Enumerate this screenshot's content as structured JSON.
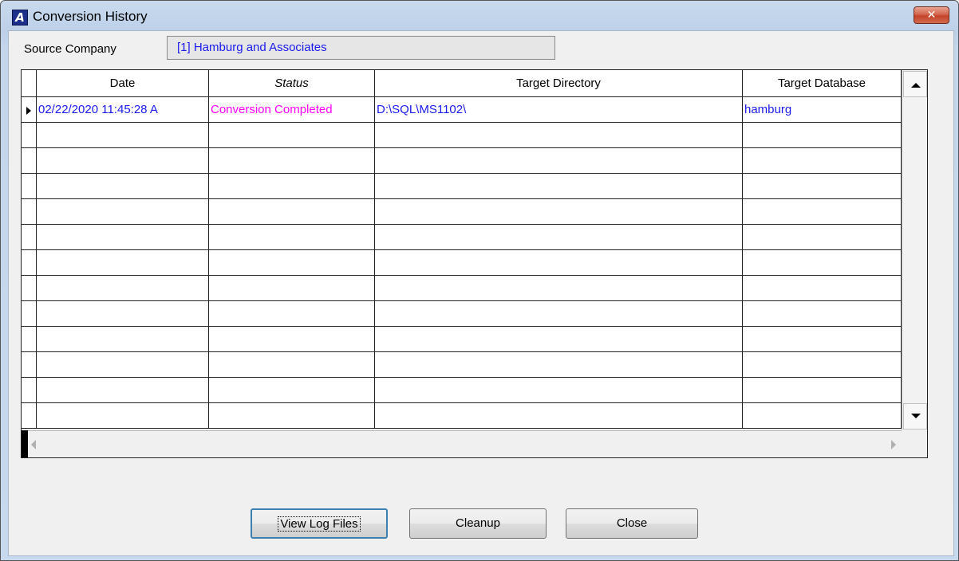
{
  "window": {
    "icon_letter": "A",
    "title": "Conversion History",
    "close_glyph": "✕"
  },
  "source": {
    "label": "Source Company",
    "value": "[1] Hamburg and Associates"
  },
  "grid": {
    "columns": [
      "Date",
      "Status",
      "Target Directory",
      "Target Database"
    ],
    "rows": [
      {
        "date": "02/22/2020 11:45:28 A",
        "status": "Conversion Completed",
        "target_directory": "D:\\SQL\\MS1102\\",
        "target_database": "hamburg"
      }
    ],
    "empty_row_count": 12
  },
  "buttons": {
    "view_log": "View Log Files",
    "cleanup": "Cleanup",
    "close": "Close"
  },
  "colors": {
    "date_text": "#1a1aee",
    "status_text": "#ff00ff",
    "link_blue": "#1a1aee"
  },
  "icons": [
    "app-icon",
    "close-icon",
    "row-indicator-icon",
    "scroll-up-icon",
    "scroll-down-icon",
    "scroll-left-icon",
    "scroll-right-icon"
  ]
}
